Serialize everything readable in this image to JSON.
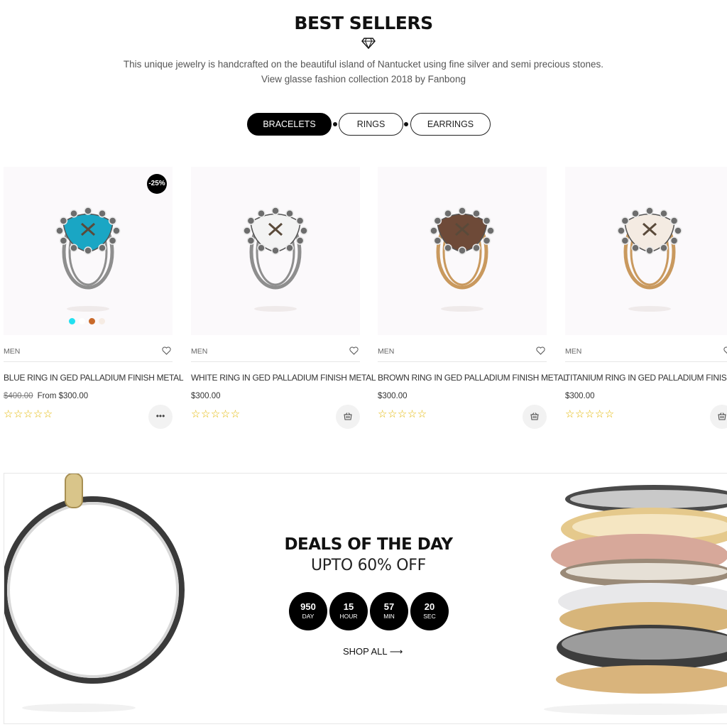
{
  "section": {
    "title": "BEST SELLERS",
    "description_line1": "This unique jewelry is handcrafted on the beautiful island of Nantucket using fine silver and semi precious stones.",
    "description_line2": "View glasse fashion collection 2018 by Fanbong"
  },
  "tabs": [
    {
      "label": "BRACELETS",
      "active": true
    },
    {
      "label": "RINGS",
      "active": false
    },
    {
      "label": "EARRINGS",
      "active": false
    }
  ],
  "products": [
    {
      "category": "MEN",
      "name": "BLUE RING IN GED PALLADIUM FINISH METAL",
      "old_price": "$400.00",
      "price": "From $300.00",
      "badge": "-25%",
      "rating_stars": "☆☆☆☆☆",
      "action_icon": "more-icon",
      "stone_color": "#1aa6c4",
      "band_color": "#8e8e8e",
      "swatches": [
        "#22e0f0",
        "#ffffff",
        "#c8692a",
        "#f6ece4"
      ]
    },
    {
      "category": "MEN",
      "name": "WHITE RING IN GED PALLADIUM FINISH METAL",
      "old_price": "",
      "price": "$300.00",
      "badge": "",
      "rating_stars": "☆☆☆☆☆",
      "action_icon": "cart-icon",
      "stone_color": "#f3f3f3",
      "band_color": "#8e8e8e",
      "swatches": []
    },
    {
      "category": "MEN",
      "name": "BROWN RING IN GED PALLADIUM FINISH METAL",
      "old_price": "",
      "price": "$300.00",
      "badge": "",
      "rating_stars": "☆☆☆☆☆",
      "action_icon": "cart-icon",
      "stone_color": "#6e4a38",
      "band_color": "#c9995e",
      "swatches": []
    },
    {
      "category": "MEN",
      "name": "TITANIUM RING IN GED PALLADIUM FINISH METAL",
      "old_price": "",
      "price": "$300.00",
      "badge": "",
      "rating_stars": "☆☆☆☆☆",
      "action_icon": "cart-icon",
      "stone_color": "#f4ebe2",
      "band_color": "#c9995e",
      "swatches": []
    }
  ],
  "deals": {
    "title": "DEALS OF THE DAY",
    "subtitle": "UPTO 60% OFF",
    "countdown": [
      {
        "value": "950",
        "unit": "DAY"
      },
      {
        "value": "15",
        "unit": "HOUR"
      },
      {
        "value": "57",
        "unit": "MIN"
      },
      {
        "value": "20",
        "unit": "SEC"
      }
    ],
    "shop_all_label": "SHOP ALL ⟶"
  },
  "colors": {
    "accent": "#000000",
    "star": "#e3b600",
    "image_bg": "#fbf9fb"
  }
}
